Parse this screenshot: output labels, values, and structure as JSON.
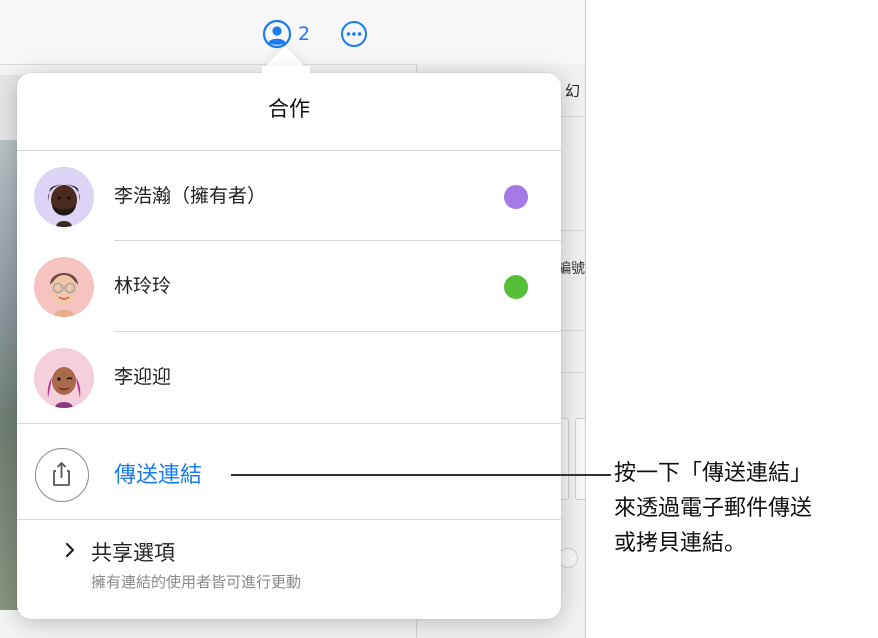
{
  "toolbar": {
    "collaborator_count": "2",
    "collaborate_icon": "person-circle-icon",
    "more_icon": "ellipsis-circle-icon"
  },
  "background": {
    "panel_tab_text": "幻",
    "panel_label_text": "編號"
  },
  "popover": {
    "title": "合作",
    "participants": [
      {
        "name": "李浩瀚（擁有者）",
        "avatar": "memoji-avatar",
        "status_color": "#a37ae6"
      },
      {
        "name": "林玲玲",
        "avatar": "memoji-avatar",
        "status_color": "#57be37"
      },
      {
        "name": "李迎迎",
        "avatar": "memoji-avatar",
        "status_color": ""
      }
    ],
    "send_link": {
      "label": "傳送連結",
      "icon": "share-icon"
    },
    "share_options": {
      "title": "共享選項",
      "subtitle": "擁有連結的使用者皆可進行更動",
      "icon": "chevron-right-icon"
    }
  },
  "callout": {
    "lines": [
      "按一下「傳送連結」",
      "來透過電子郵件傳送",
      "或拷貝連結。"
    ]
  },
  "colors": {
    "accent": "#1a7cf0",
    "owner_status": "#a37ae6",
    "member_status": "#57be37"
  }
}
